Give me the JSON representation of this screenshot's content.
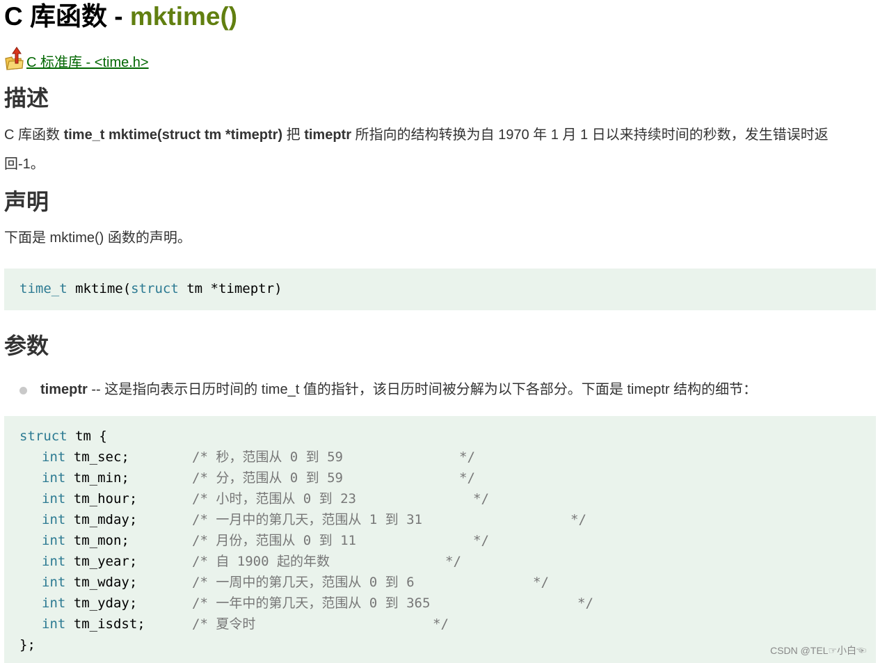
{
  "title": {
    "prefix": "C 库函数 - ",
    "function": "mktime()"
  },
  "back_link": {
    "label": "C 标准库 - <time.h>"
  },
  "sections": {
    "description": {
      "heading": "描述",
      "text_1": "C 库函数 ",
      "bold_1": "time_t mktime(struct tm *timeptr)",
      "text_2": " 把 ",
      "bold_2": "timeptr",
      "text_3": " 所指向的结构转换为自 1970 年 1 月 1 日以来持续时间的秒数，发生错误时返",
      "text_4": "回-1。"
    },
    "declaration": {
      "heading": "声明",
      "text": "下面是 mktime() 函数的声明。",
      "code": {
        "type": "time_t",
        "name": " mktime(",
        "kw": "struct",
        "rest": " tm *timeptr)"
      }
    },
    "parameters": {
      "heading": "参数",
      "bullet_bold": "timeptr",
      "bullet_text": " -- 这是指向表示日历时间的 time_t 值的指针，该日历时间被分解为以下各部分。下面是 timeptr 结构的细节："
    }
  },
  "struct_code": {
    "open_kw": "struct",
    "open_rest": " tm {",
    "fields": [
      {
        "kw": "int",
        "decl": " tm_sec;",
        "comment": "/* 秒，范围从 0 到 59",
        "end": "*/"
      },
      {
        "kw": "int",
        "decl": " tm_min;",
        "comment": "/* 分，范围从 0 到 59",
        "end": "*/"
      },
      {
        "kw": "int",
        "decl": " tm_hour;",
        "comment": "/* 小时，范围从 0 到 23",
        "end": "*/"
      },
      {
        "kw": "int",
        "decl": " tm_mday;",
        "comment": "/* 一月中的第几天，范围从 1 到 31",
        "end": "*/"
      },
      {
        "kw": "int",
        "decl": " tm_mon;",
        "comment": "/* 月份，范围从 0 到 11",
        "end": "*/"
      },
      {
        "kw": "int",
        "decl": " tm_year;",
        "comment": "/* 自 1900 起的年数",
        "end": "*/"
      },
      {
        "kw": "int",
        "decl": " tm_wday;",
        "comment": "/* 一周中的第几天，范围从 0 到 6",
        "end": "*/"
      },
      {
        "kw": "int",
        "decl": " tm_yday;",
        "comment": "/* 一年中的第几天，范围从 0 到 365",
        "end": "*/"
      },
      {
        "kw": "int",
        "decl": " tm_isdst;",
        "comment": "/* 夏令时",
        "end": "*/"
      }
    ],
    "close": "};"
  },
  "watermark": "CSDN @TEL☞小白☜",
  "colors": {
    "accent_green": "#617f10",
    "link_green": "#006600",
    "code_bg": "#eaf3ec",
    "code_keyword": "#2c7a92"
  }
}
